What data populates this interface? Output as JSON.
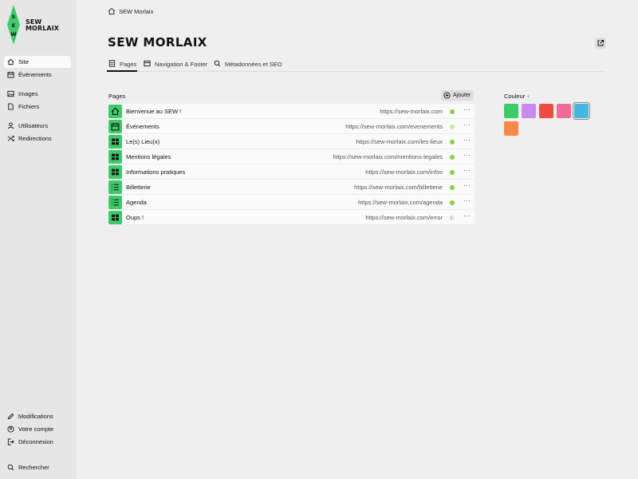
{
  "brand": {
    "line1": "SEW",
    "line2": "MORLAIX",
    "mark_letters": [
      "S",
      "E",
      "W"
    ]
  },
  "sidebar": {
    "items": [
      {
        "label": "Site",
        "icon": "home-icon",
        "active": true
      },
      {
        "label": "Événements",
        "icon": "calendar-icon",
        "active": false
      },
      {
        "label": "Images",
        "icon": "image-icon",
        "active": false
      },
      {
        "label": "Fichiers",
        "icon": "file-icon",
        "active": false
      },
      {
        "label": "Utilisateurs",
        "icon": "users-icon",
        "active": false
      },
      {
        "label": "Redirections",
        "icon": "shuffle-icon",
        "active": false
      }
    ],
    "bottom": [
      {
        "label": "Modifications",
        "icon": "pencil-icon"
      },
      {
        "label": "Votre compte",
        "icon": "account-icon"
      },
      {
        "label": "Déconnexion",
        "icon": "logout-icon"
      }
    ],
    "search": {
      "label": "Rechercher",
      "icon": "search-icon"
    }
  },
  "breadcrumb": {
    "label": "SEW Morlaix",
    "icon": "home-icon"
  },
  "page": {
    "title": "SEW MORLAIX"
  },
  "tabs": [
    {
      "label": "Pages",
      "icon": "page-icon",
      "active": true
    },
    {
      "label": "Navigation & Footer",
      "icon": "layout-icon",
      "active": false
    },
    {
      "label": "Métadonnées et SEO",
      "icon": "search-icon",
      "active": false
    }
  ],
  "pages_section": {
    "title": "Pages",
    "add_label": "Ajouter"
  },
  "pages": [
    {
      "name": "Bienvenue au SEW !",
      "url": "https://sew-morlaix.com",
      "icon": "home-icon",
      "status": "published"
    },
    {
      "name": "Événements",
      "url": "https://sew-morlaix.com/evenements",
      "icon": "calendar-icon",
      "status": "draft"
    },
    {
      "name": "Le(s) Lieu(x)",
      "url": "https://sew-morlaix.com/les-lieux",
      "icon": "grid-icon",
      "status": "published"
    },
    {
      "name": "Mentions légales",
      "url": "https://sew-morlaix.com/mentions-legales",
      "icon": "grid-icon",
      "status": "published"
    },
    {
      "name": "Informations pratiques",
      "url": "https://sew-morlaix.com/infos",
      "icon": "grid-icon",
      "status": "published"
    },
    {
      "name": "Billetterie",
      "url": "https://sew-morlaix.com/billetterie",
      "icon": "list-icon",
      "status": "published"
    },
    {
      "name": "Agenda",
      "url": "https://sew-morlaix.com/agenda",
      "icon": "list-icon",
      "status": "published"
    },
    {
      "name": "Oups !",
      "url": "https://sew-morlaix.com/error",
      "icon": "grid-icon",
      "status": "partial"
    }
  ],
  "color_section": {
    "title": "Couleur",
    "plus": "+",
    "swatches": [
      "#3ec96a",
      "#c98aef",
      "#ef4a44",
      "#f16b9a",
      "#43b6e2",
      "#f48a45"
    ],
    "selected_index": 4
  },
  "colors": {
    "accent": "#3ec96a",
    "status_published": "#8ccf3f",
    "status_draft": "#cfe7a6"
  }
}
